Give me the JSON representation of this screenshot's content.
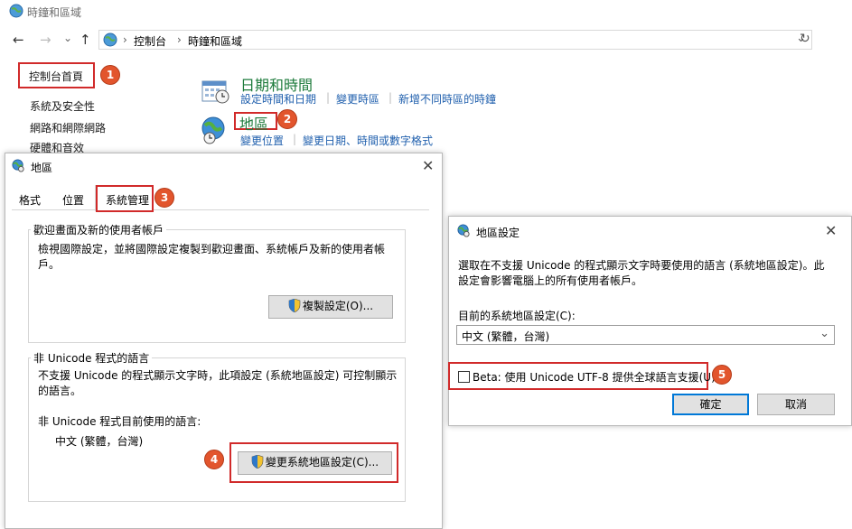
{
  "window": {
    "title": "時鐘和區域"
  },
  "nav": {
    "back": "←",
    "forward": "→",
    "history": "⌄",
    "up": "↑",
    "breadcrumb": [
      "控制台",
      "時鐘和區域"
    ],
    "separator": "›",
    "dropdown": "⌄",
    "refresh": "↻"
  },
  "sidebar": {
    "items": [
      {
        "label": "控制台首頁"
      },
      {
        "label": "系統及安全性"
      },
      {
        "label": "網路和網際網路"
      },
      {
        "label": "硬體和音效"
      }
    ]
  },
  "categories": [
    {
      "title": "日期和時間",
      "links": [
        "設定時間和日期",
        "變更時區",
        "新增不同時區的時鐘"
      ]
    },
    {
      "title": "地區",
      "links": [
        "變更位置",
        "變更日期、時間或數字格式"
      ]
    }
  ],
  "badges": [
    "1",
    "2",
    "3",
    "4",
    "5"
  ],
  "region_dialog": {
    "title": "地區",
    "close": "✕",
    "tabs": [
      "格式",
      "位置",
      "系統管理"
    ],
    "welcome_group": {
      "label": "歡迎畫面及新的使用者帳戶",
      "text": "檢視國際設定，並將國際設定複製到歡迎畫面、系統帳戶及新的使用者帳戶。",
      "button": "複製設定(O)..."
    },
    "unicode_group": {
      "label": "非 Unicode 程式的語言",
      "text": "不支援 Unicode 的程式顯示文字時，此項設定 (系統地區設定) 可控制顯示的語言。",
      "current_label": "非 Unicode 程式目前使用的語言:",
      "current_value": "中文 (繁體，台灣)",
      "button": "變更系統地區設定(C)..."
    }
  },
  "locale_dialog": {
    "title": "地區設定",
    "close": "✕",
    "description": "選取在不支援 Unicode 的程式顯示文字時要使用的語言 (系統地區設定)。此設定會影響電腦上的所有使用者帳戶。",
    "current_label": "目前的系統地區設定(C):",
    "current_value": "中文 (繁體，台灣)",
    "beta_label": "Beta: 使用 Unicode UTF-8 提供全球語言支援(U)",
    "beta_checked": false,
    "ok": "確定",
    "cancel": "取消"
  },
  "colors": {
    "accent_red": "#d12a2a",
    "badge_orange": "#e2552d",
    "link_blue": "#1f5fad",
    "heading_green": "#1e7b3c",
    "focus_blue": "#0078d7"
  }
}
